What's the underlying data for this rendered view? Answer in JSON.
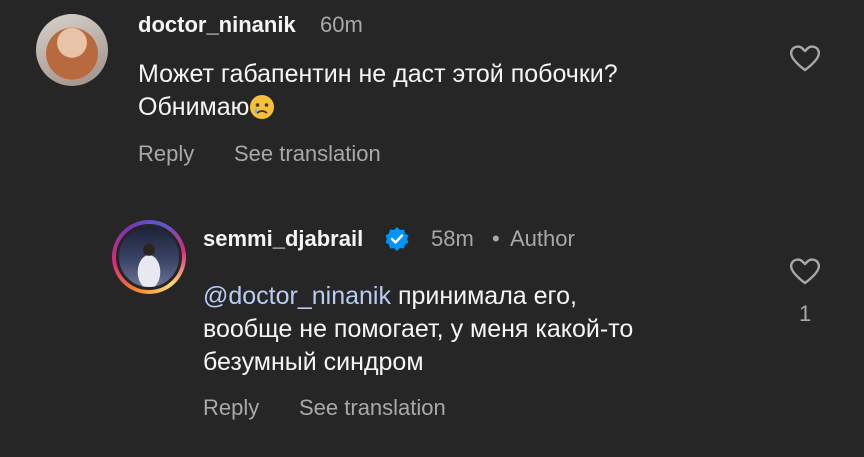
{
  "comments": [
    {
      "username": "doctor_ninanik",
      "time": "60m",
      "text_line1": "Может габапентин не даст этой побочки?",
      "text_line2": "Обнимаю",
      "emoji": "crying-face",
      "reply_label": "Reply",
      "translate_label": "See translation",
      "avatar": "profile-photo"
    },
    {
      "username": "semmi_djabrail",
      "verified": true,
      "time": "58m",
      "separator": "•",
      "author_label": "Author",
      "mention": "@doctor_ninanik",
      "text_line1_rest": " принимала его,",
      "text_line2": "вообще не помогает, у меня какой-то",
      "text_line3": "безумный синдром",
      "like_count": "1",
      "reply_label": "Reply",
      "translate_label": "See translation",
      "avatar": "profile-photo-with-story-ring"
    }
  ],
  "colors": {
    "background": "#262626",
    "text": "#f5f5f5",
    "secondary": "#a8a8a8",
    "mention": "#b9cdf0",
    "verified": "#0095f6"
  }
}
